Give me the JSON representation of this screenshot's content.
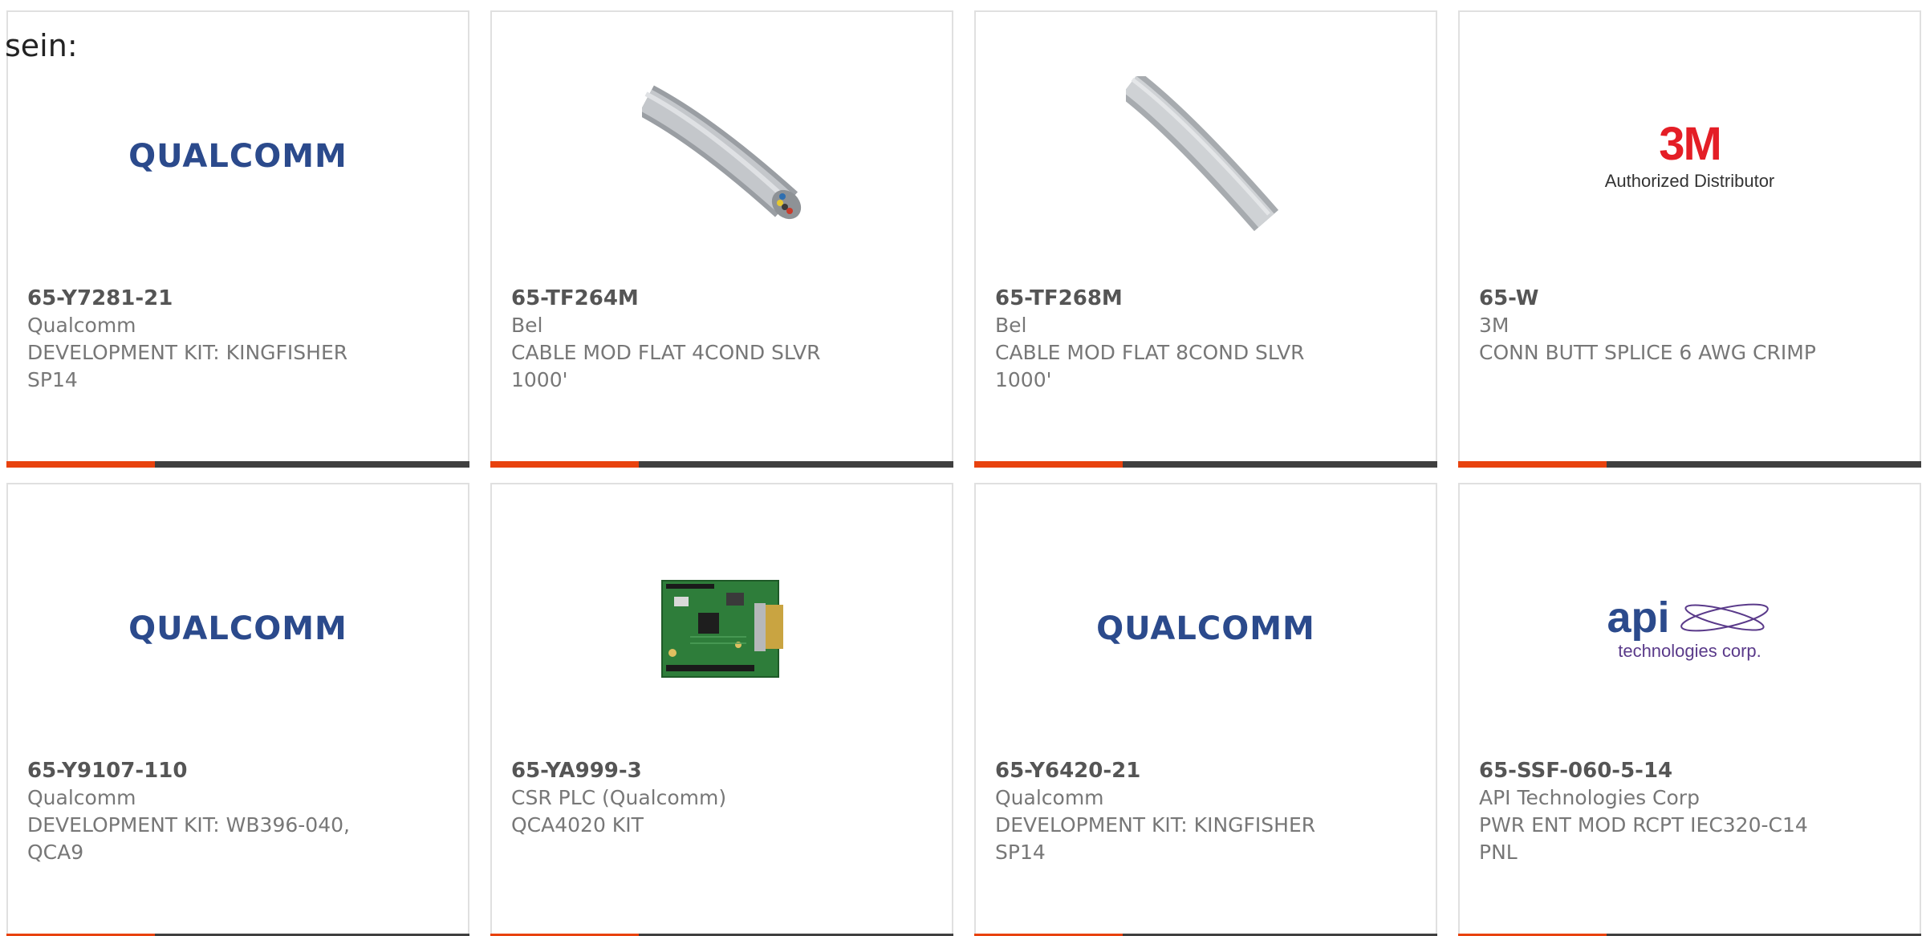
{
  "intro_text": "sein:",
  "colors": {
    "accent": "#e8420e",
    "bar": "#3f3f3f",
    "border": "#e0e0e0"
  },
  "products": [
    {
      "part_no": "65-Y7281-21",
      "manufacturer": "Qualcomm",
      "description": "DEVELOPMENT KIT: KINGFISHER SP14",
      "image": "qualcomm-logo",
      "logo_text": "QUALCOMM"
    },
    {
      "part_no": "65-TF264M",
      "manufacturer": "Bel",
      "description": "CABLE MOD FLAT 4COND SLVR 1000'",
      "image": "flat-cable-4cond-photo"
    },
    {
      "part_no": "65-TF268M",
      "manufacturer": "Bel",
      "description": "CABLE MOD FLAT 8COND SLVR 1000'",
      "image": "flat-cable-8cond-photo"
    },
    {
      "part_no": "65-W",
      "manufacturer": "3M",
      "description": "CONN BUTT SPLICE 6 AWG CRIMP",
      "image": "3m-logo",
      "logo_text": "3M",
      "logo_subtext": "Authorized Distributor"
    },
    {
      "part_no": "65-Y9107-110",
      "manufacturer": "Qualcomm",
      "description": "DEVELOPMENT KIT: WB396-040, QCA9",
      "image": "qualcomm-logo",
      "logo_text": "QUALCOMM"
    },
    {
      "part_no": "65-YA999-3",
      "manufacturer": "CSR PLC (Qualcomm)",
      "description": "QCA4020 KIT",
      "image": "pcb-board-photo"
    },
    {
      "part_no": "65-Y6420-21",
      "manufacturer": "Qualcomm",
      "description": "DEVELOPMENT KIT: KINGFISHER SP14",
      "image": "qualcomm-logo",
      "logo_text": "QUALCOMM"
    },
    {
      "part_no": "65-SSF-060-5-14",
      "manufacturer": "API Technologies Corp",
      "description": "PWR ENT MOD RCPT IEC320-C14 PNL",
      "image": "api-technologies-logo",
      "logo_text": "api",
      "logo_subtext": "technologies corp."
    }
  ]
}
